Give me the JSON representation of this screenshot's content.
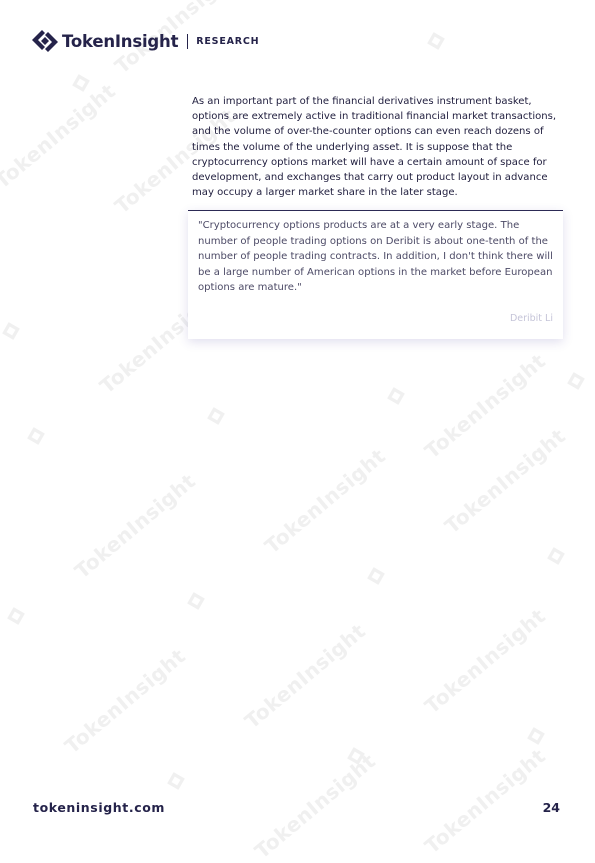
{
  "header": {
    "brand_name": "TokenInsight",
    "section_label": "RESEARCH"
  },
  "body": {
    "paragraph": "As an important part of the financial derivatives instrument basket, options are extremely active in traditional financial market transactions, and the volume of over-the-counter options can even reach dozens of times the volume of the underlying asset. It is suppose that the cryptocurrency options market will have a certain amount of space for development, and exchanges that carry out product layout in advance may occupy a larger market share in the later stage."
  },
  "quote": {
    "text": "\"Cryptocurrency options products are at a very early stage. The number of people trading options on Deribit is about one-tenth of the number of people trading contracts. In addition, I don't think there will be a large number of American options in the market before European options are mature.\"",
    "author": "Deribit Li"
  },
  "footer": {
    "url": "tokeninsight.com",
    "page_number": "24"
  },
  "watermark": {
    "text": "TokenInsight",
    "color": "#f0f0f0"
  },
  "colors": {
    "brand_navy": "#25234a",
    "body_text": "#1f1d3d",
    "quote_text": "#4c4a66",
    "quote_author": "#c5c4d8"
  }
}
